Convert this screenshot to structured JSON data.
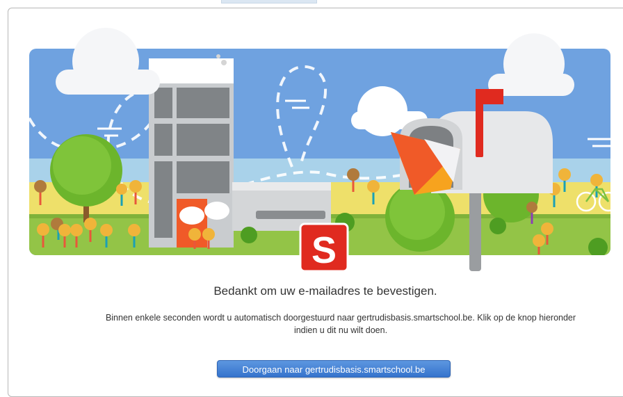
{
  "confirmation": {
    "title": "Bedankt om uw e-mailadres te bevestigen.",
    "message": "Binnen enkele seconden wordt u automatisch doorgestuurd naar gertrudisbasis.smartschool.be. Klik op de knop hieronder indien u dit nu wilt doen.",
    "continue_button_label": "Doorgaan naar gertrudisbasis.smartschool.be"
  },
  "logo": {
    "letter": "S"
  },
  "colors": {
    "sky": "#6fa2e0",
    "grass": "#93c447",
    "accent_red": "#e02a1f",
    "button_blue": "#3d7fd6"
  },
  "icons": [
    "smartschool-logo-icon",
    "mailbox-icon",
    "flag-icon",
    "envelope-icon",
    "bicycle-icon",
    "cloud-icon",
    "tree-icon",
    "building-icon",
    "speech-bubble-icon"
  ]
}
